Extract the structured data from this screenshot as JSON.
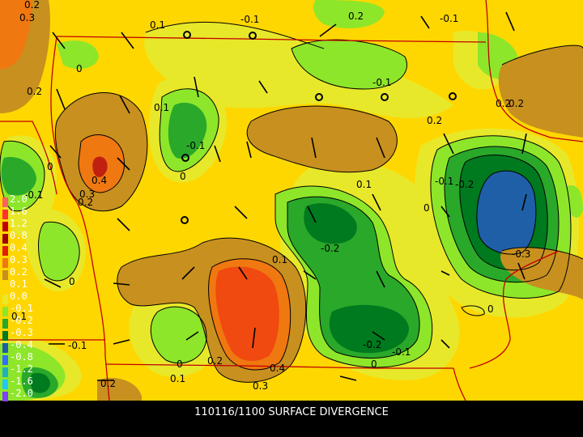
{
  "title": "110116/1100 SURFACE DIVERGENCE",
  "colors": {
    "background": "#000000",
    "band_neg_03": "#1f5fa8",
    "band_neg_02": "#007a1e",
    "band_neg_01": "#2aa82a",
    "band_0": "#8ee62a",
    "band_pos_00": "#e8e82a",
    "band_pos_01": "#ffd700",
    "band_pos_02": "#c8901e",
    "band_pos_03": "#f07810",
    "band_pos_04": "#f04a10",
    "boundary": "#c00000",
    "contour": "#000000"
  },
  "legend": [
    {
      "label": "2.0",
      "color": "#ff6060"
    },
    {
      "label": "1.6",
      "color": "#ff3030"
    },
    {
      "label": "1.2",
      "color": "#c00000"
    },
    {
      "label": "0.8",
      "color": "#a00000"
    },
    {
      "label": "0.4",
      "color": "#e02000"
    },
    {
      "label": "0.3",
      "color": "#f07810"
    },
    {
      "label": "0.2",
      "color": "#c8901e"
    },
    {
      "label": "0.1",
      "color": "#ffd700"
    },
    {
      "label": "0.0",
      "color": "#e8e82a"
    },
    {
      "label": "-0.1",
      "color": "#8ee62a"
    },
    {
      "label": "-0.2",
      "color": "#2aa82a"
    },
    {
      "label": "-0.3",
      "color": "#007a1e"
    },
    {
      "label": "-0.4",
      "color": "#1f5fa8"
    },
    {
      "label": "-0.8",
      "color": "#3070ff"
    },
    {
      "label": "-1.2",
      "color": "#20b0c0"
    },
    {
      "label": "-1.6",
      "color": "#20c8ff"
    },
    {
      "label": "-2.0",
      "color": "#8040ff"
    }
  ],
  "contour_labels": [
    {
      "text": "0.3"
    },
    {
      "text": "0.1"
    },
    {
      "text": "-0.1"
    },
    {
      "text": "0.2"
    },
    {
      "text": "-0.1"
    },
    {
      "text": "0"
    },
    {
      "text": "0.2"
    },
    {
      "text": "0.1"
    },
    {
      "text": "-0.1"
    },
    {
      "text": "0.2"
    },
    {
      "text": "0"
    },
    {
      "text": "-0.1"
    },
    {
      "text": "-0.1"
    },
    {
      "text": "0.4"
    },
    {
      "text": "0.3"
    },
    {
      "text": "0.2"
    },
    {
      "text": "0"
    },
    {
      "text": "0.1"
    },
    {
      "text": "0.2"
    },
    {
      "text": "-0.1"
    },
    {
      "text": "-0.2"
    },
    {
      "text": "0"
    },
    {
      "text": "0.1"
    },
    {
      "text": "-0.2"
    },
    {
      "text": "0"
    },
    {
      "text": "-0.3"
    },
    {
      "text": "0"
    },
    {
      "text": "0.1"
    },
    {
      "text": "-0.1"
    },
    {
      "text": "0"
    },
    {
      "text": "0.2"
    },
    {
      "text": "0.4"
    },
    {
      "text": "0.3"
    },
    {
      "text": "-0.2"
    },
    {
      "text": "-0.1"
    },
    {
      "text": "0"
    },
    {
      "text": "0.1"
    },
    {
      "text": "0.2"
    },
    {
      "text": "0.2"
    },
    {
      "text": "0.2"
    }
  ]
}
